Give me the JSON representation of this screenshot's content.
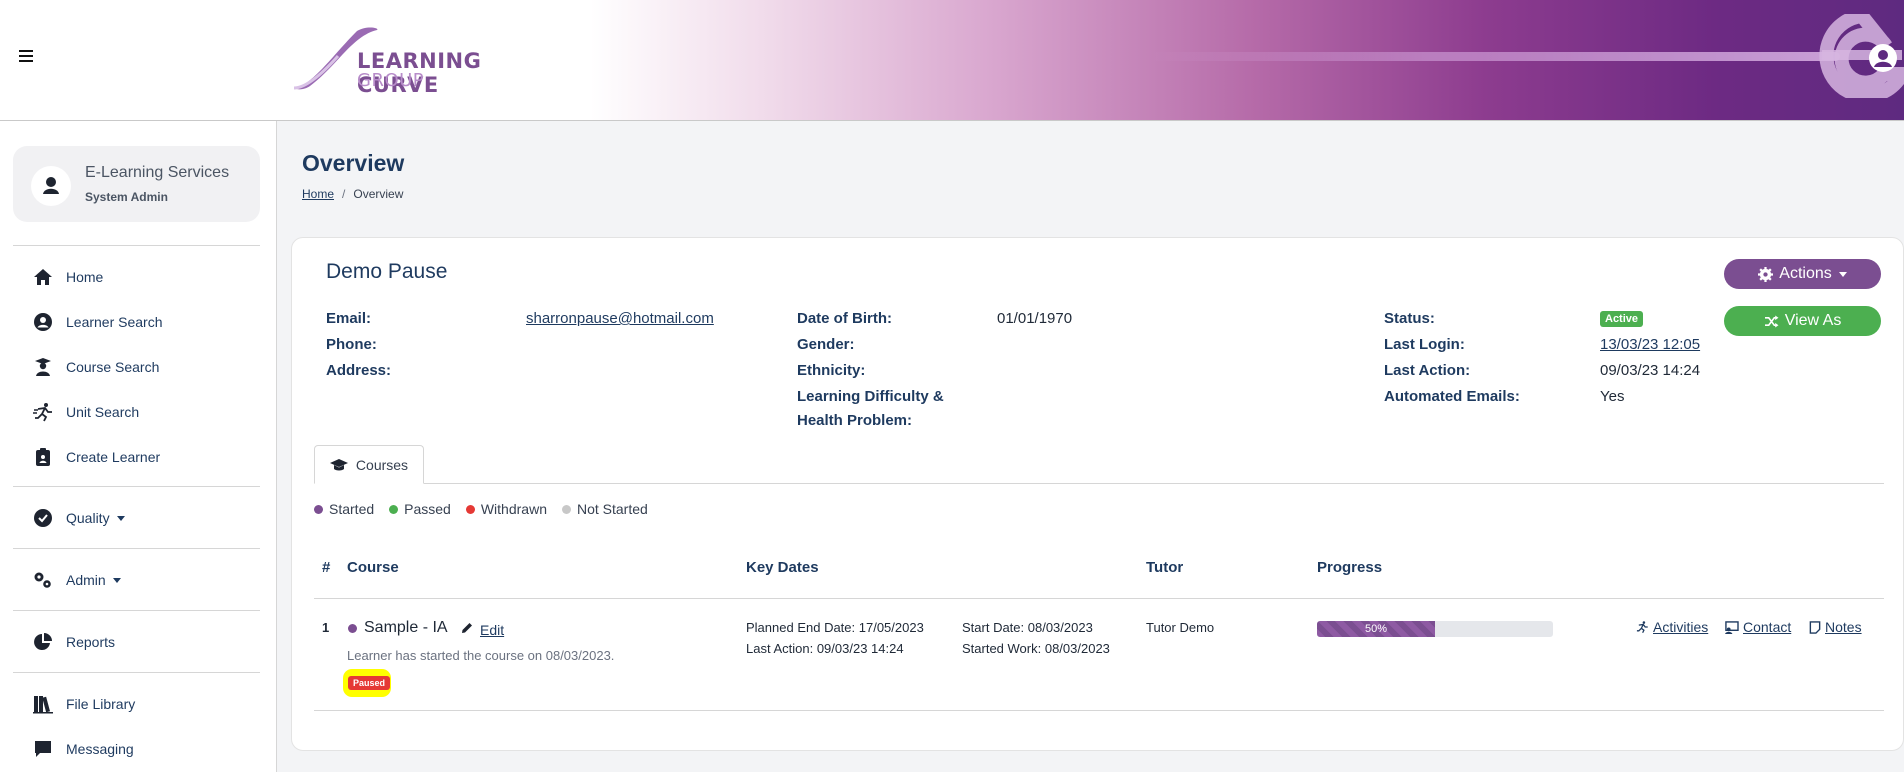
{
  "brand": {
    "line1": "LEARNING CURVE",
    "line2": "GROUP"
  },
  "sidebar": {
    "user": {
      "name": "E-Learning Services",
      "role": "System Admin"
    },
    "items": [
      {
        "label": "Home",
        "icon": "home-icon"
      },
      {
        "label": "Learner Search",
        "icon": "user-circle-icon"
      },
      {
        "label": "Course Search",
        "icon": "graduate-icon"
      },
      {
        "label": "Unit Search",
        "icon": "running-person-icon"
      },
      {
        "label": "Create Learner",
        "icon": "clipboard-icon"
      },
      {
        "label": "Quality",
        "icon": "check-circle-icon"
      },
      {
        "label": "Admin",
        "icon": "cogs-icon"
      },
      {
        "label": "Reports",
        "icon": "pie-chart-icon"
      },
      {
        "label": "File Library",
        "icon": "books-icon"
      },
      {
        "label": "Messaging",
        "icon": "message-icon"
      }
    ]
  },
  "page": {
    "title": "Overview",
    "breadcrumb": {
      "home": "Home",
      "sep": "/",
      "current": "Overview"
    }
  },
  "learner": {
    "name": "Demo Pause",
    "fields": {
      "email_label": "Email:",
      "email_value": "sharronpause@hotmail.com",
      "phone_label": "Phone:",
      "address_label": "Address:",
      "dob_label": "Date of Birth:",
      "dob_value": "01/01/1970",
      "gender_label": "Gender:",
      "ethnicity_label": "Ethnicity:",
      "ldd_label_1": "Learning Difficulty &",
      "ldd_label_2": "Health Problem:",
      "status_label": "Status:",
      "status_value": "Active",
      "last_login_label": "Last Login:",
      "last_login_value": "13/03/23 12:05",
      "last_action_label": "Last Action:",
      "last_action_value": "09/03/23 14:24",
      "auto_emails_label": "Automated Emails:",
      "auto_emails_value": "Yes"
    },
    "buttons": {
      "actions": "Actions",
      "view_as": "View As"
    }
  },
  "tabs": [
    {
      "label": "Courses",
      "icon": "graduation-cap-icon"
    }
  ],
  "legend": [
    {
      "label": "Started",
      "color": "#7b4e91"
    },
    {
      "label": "Passed",
      "color": "#4caf50"
    },
    {
      "label": "Withdrawn",
      "color": "#e53935"
    },
    {
      "label": "Not Started",
      "color": "#c8c8c8"
    }
  ],
  "table": {
    "headers": {
      "num": "#",
      "course": "Course",
      "key_dates": "Key Dates",
      "tutor": "Tutor",
      "progress": "Progress"
    },
    "rows": [
      {
        "num": "1",
        "course": "Sample - IA",
        "edit": "Edit",
        "note": "Learner has started the course on 08/03/2023.",
        "badge": "Paused",
        "planned_end": "Planned End Date: 17/05/2023",
        "last_action": "Last Action: 09/03/23 14:24",
        "start_date": "Start Date: 08/03/2023",
        "started_work": "Started Work: 08/03/2023",
        "tutor": "Tutor Demo",
        "progress": 0.5,
        "progress_label": "50%",
        "links": {
          "activities": "Activities",
          "contact": "Contact",
          "notes": "Notes"
        }
      }
    ]
  }
}
